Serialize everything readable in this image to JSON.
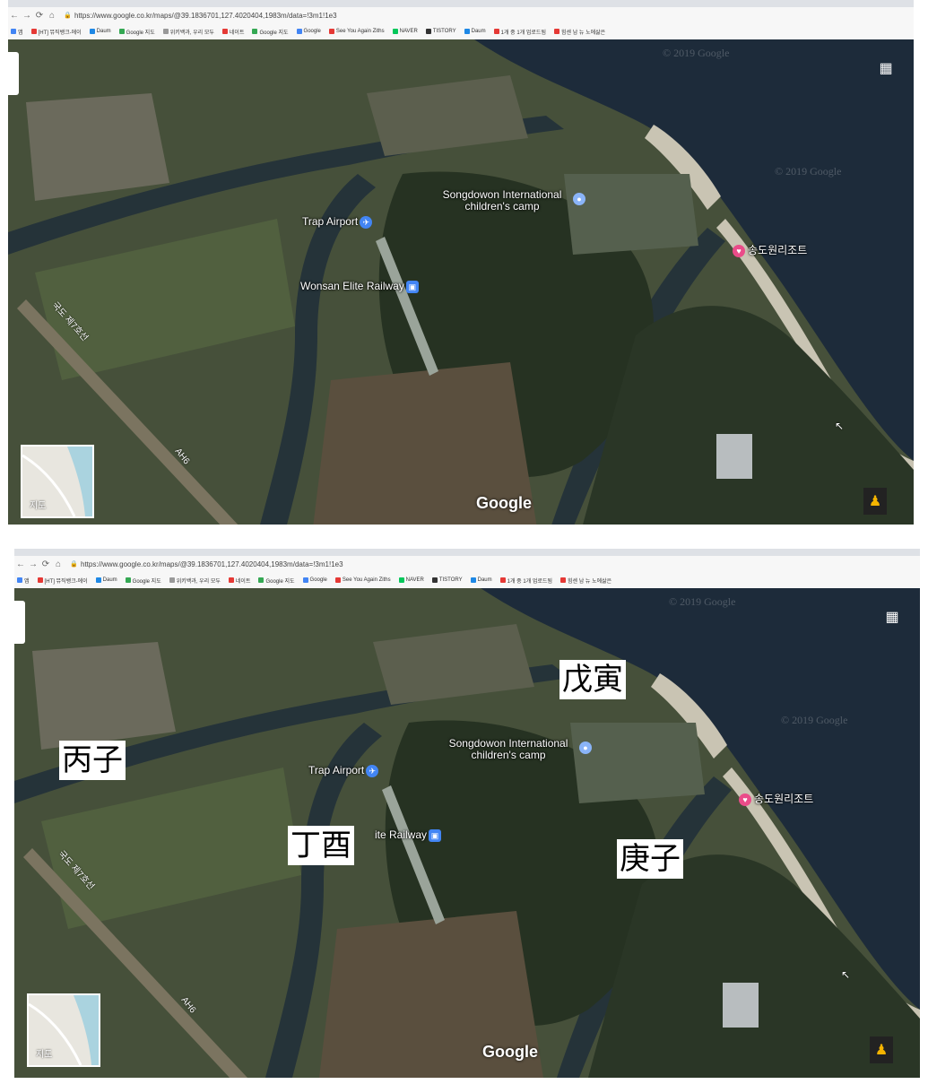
{
  "browser": {
    "url": "https://www.google.co.kr/maps/@39.1836701,127.4020404,1983m/data=!3m1!1e3",
    "bookmarks": [
      "앱",
      "[HT] 뮤직뱅크-에이",
      "Daum",
      "Google 지도",
      "위키백과, 우리 모두",
      "네이트",
      "Google 지도",
      "Google",
      "See You Again Ziths",
      "NAVER",
      "TISTORY",
      "Daum",
      "1개 중 1개 업로드됨",
      "힘센 남 뉴 노에삶은"
    ]
  },
  "map": {
    "labels": {
      "camp": "Songdowon International children's camp",
      "airport": "Trap Airport",
      "railway": "Wonsan Elite Railway",
      "railway_partial": "ite Railway",
      "resort": "송도원리조트",
      "road_a": "국도 제7호선",
      "road_b": "AH6"
    },
    "watermark": "© 2019 Google",
    "logo": "Google",
    "minimap_label": "지도"
  },
  "annotations": {
    "a": "丙子",
    "b": "丁酉",
    "c": "戊寅",
    "d": "庚子"
  },
  "colors": {
    "sea": "#1d2b3a",
    "river": "#253339",
    "fields": "#4a5538",
    "beach": "#c9c4b3",
    "forest": "#263222"
  }
}
